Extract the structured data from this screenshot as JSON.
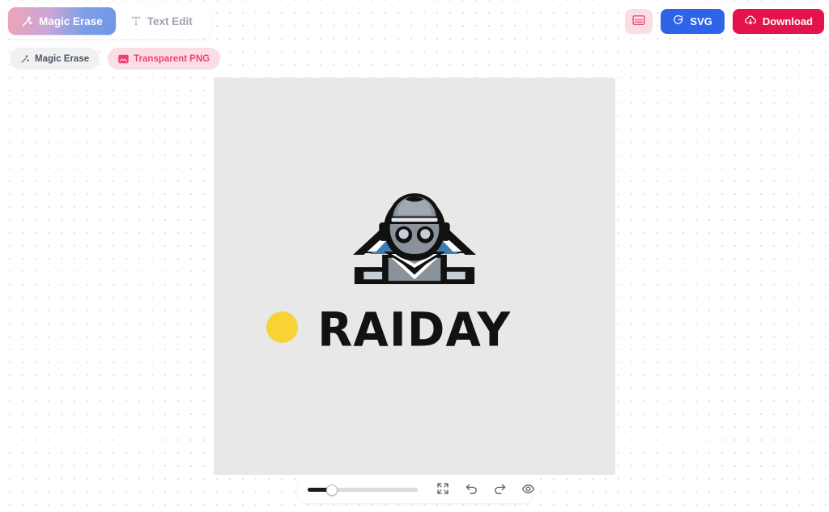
{
  "app": {
    "background_color": "#ffffff",
    "dot_color": "#e7e5e4"
  },
  "tabs": [
    {
      "id": "magic-erase",
      "label": "Magic Erase",
      "icon": "magic-wand-icon",
      "active": true
    },
    {
      "id": "text-edit",
      "label": "Text Edit",
      "icon": "text-type-icon",
      "active": false
    }
  ],
  "chips": [
    {
      "id": "magic-erase",
      "label": "Magic Erase",
      "icon": "wand-sparkle-icon",
      "style": "gray"
    },
    {
      "id": "transparent-png",
      "label": "Transparent PNG",
      "icon": "image-icon",
      "style": "pink",
      "color": "#ec4371"
    }
  ],
  "actions": {
    "card_button": {
      "label": "",
      "icon": "card-image-icon",
      "color": "#ec4371",
      "background": "#fbdde6"
    },
    "svg_button": {
      "label": "SVG",
      "icon": "magic-swirl-icon",
      "background": "#2f63e8"
    },
    "download_button": {
      "label": "Download",
      "icon": "cloud-download-icon",
      "background": "#e5134b"
    }
  },
  "canvas": {
    "background_color": "#e8e8e8",
    "brush_cursor": {
      "color": "#f8d335",
      "size": 39
    },
    "artwork": {
      "name": "RAIDAY",
      "wordmark": "RAIDAY",
      "mascot": "robot-head-mascot",
      "colors": {
        "accent_blue": "#3d7cb5",
        "outline_black": "#111111",
        "metal_gray": "#8a929c",
        "light_gray": "#c9ced4",
        "white": "#ffffff"
      }
    }
  },
  "bottom_toolbar": {
    "zoom_slider": {
      "name": "brush-size-slider",
      "value": 22,
      "min": 0,
      "max": 100
    },
    "buttons": [
      {
        "id": "fit-screen",
        "icon": "expand-fullscreen-icon"
      },
      {
        "id": "undo",
        "icon": "undo-icon"
      },
      {
        "id": "redo",
        "icon": "redo-icon"
      },
      {
        "id": "preview",
        "icon": "eye-icon"
      }
    ]
  }
}
